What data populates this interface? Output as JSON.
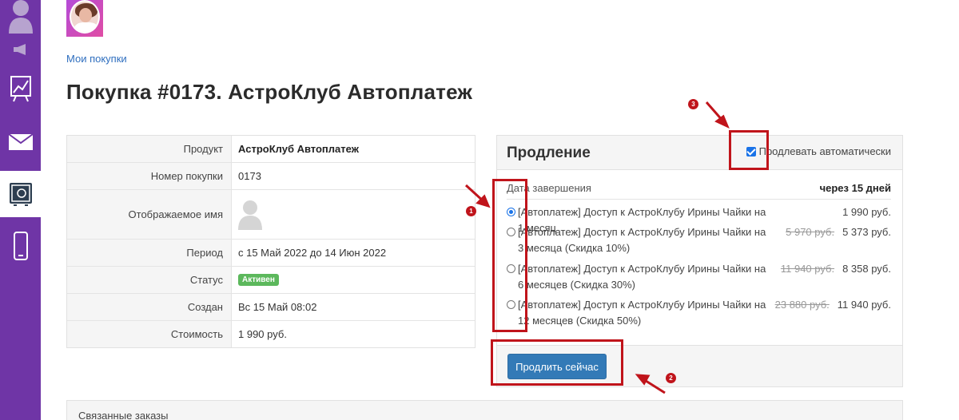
{
  "breadcrumb": "Мои покупки",
  "page_title": "Покупка #0173. АстроКлуб Автоплатеж",
  "details": {
    "product_label": "Продукт",
    "product_value": "АстроКлуб Автоплатеж",
    "number_label": "Номер покупки",
    "number_value": "0173",
    "display_name_label": "Отображаемое имя",
    "period_label": "Период",
    "period_value": "с 15 Май 2022 до 14 Июн 2022",
    "status_label": "Статус",
    "status_value": "Активен",
    "created_label": "Создан",
    "created_value": "Вс 15 Май 08:02",
    "cost_label": "Стоимость",
    "cost_value": "1 990 руб."
  },
  "renewal": {
    "title": "Продление",
    "auto_label": "Продлевать автоматически",
    "auto_checked": true,
    "end_label": "Дата завершения",
    "end_value": "через 15 дней",
    "options": [
      {
        "text": "[Автоплатеж] Доступ к АстроКлубу Ирины Чайки на 1 месяц",
        "old_price": "",
        "price": "1 990 руб.",
        "checked": true
      },
      {
        "text": "[Автоплатеж] Доступ к АстроКлубу Ирины Чайки на 3 месяца (Скидка 10%)",
        "old_price": "5 970 руб.",
        "price": "5 373 руб.",
        "checked": false
      },
      {
        "text": "[Автоплатеж] Доступ к АстроКлубу Ирины Чайки на 6 месяцев (Скидка 30%)",
        "old_price": "11 940 руб.",
        "price": "8 358 руб.",
        "checked": false
      },
      {
        "text": "[Автоплатеж] Доступ к АстроКлубу Ирины Чайки на 12 месяцев (Скидка 50%)",
        "old_price": "23 880 руб.",
        "price": "11 940 руб.",
        "checked": false
      }
    ],
    "button_label": "Продлить сейчас"
  },
  "related_title": "Связанные заказы",
  "annotations": {
    "n1": "1",
    "n2": "2",
    "n3": "3"
  },
  "colors": {
    "sidebar": "#6f35a6",
    "primary_button": "#337ab7",
    "badge": "#5cb85c",
    "annotation": "#c0141b"
  },
  "icons": [
    "user-icon",
    "megaphone-icon",
    "chart-icon",
    "mail-icon",
    "safe-icon",
    "phone-icon"
  ]
}
